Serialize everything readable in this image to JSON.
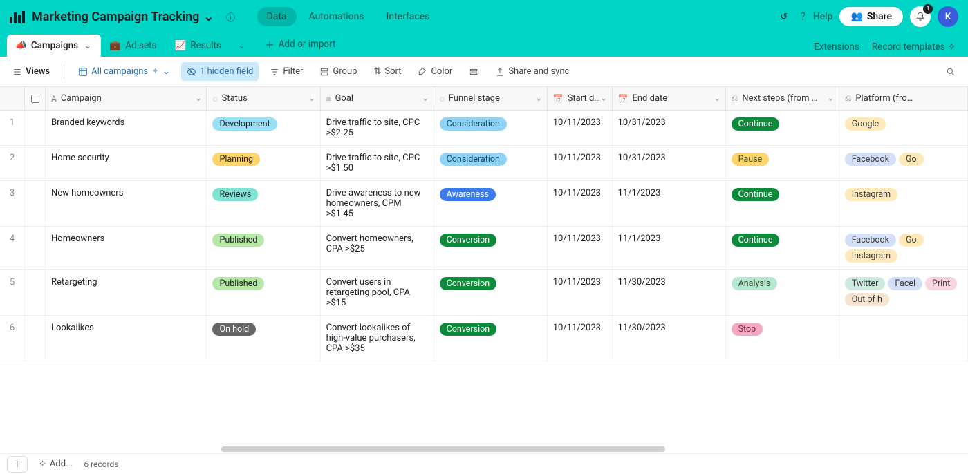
{
  "header": {
    "title": "Marketing Campaign Tracking",
    "nav": {
      "data": "Data",
      "automations": "Automations",
      "interfaces": "Interfaces"
    },
    "help": "Help",
    "share": "Share",
    "notif_count": "1",
    "avatar_initial": "K"
  },
  "tabs": {
    "campaigns": {
      "emoji": "📣",
      "label": "Campaigns"
    },
    "adsets": {
      "emoji": "💼",
      "label": "Ad sets"
    },
    "results": {
      "emoji": "📈",
      "label": "Results"
    },
    "add": "Add or import",
    "extensions": "Extensions",
    "templates": "Record templates"
  },
  "toolbar": {
    "views": "Views",
    "all": "All campaigns",
    "hidden": "1 hidden field",
    "filter": "Filter",
    "group": "Group",
    "sort": "Sort",
    "color": "Color",
    "share_sync": "Share and sync"
  },
  "columns": {
    "campaign": "Campaign",
    "status": "Status",
    "goal": "Goal",
    "funnel": "Funnel stage",
    "start": "Start d…",
    "end": "End date",
    "next": "Next steps (from …",
    "platform": "Platform (fro…"
  },
  "status_colors": {
    "Development": "#97e1f7",
    "Planning": "#ffd56b",
    "Reviews": "#7ee3d2",
    "Published": "#b5e8a4",
    "On hold": "#666"
  },
  "funnel_colors": {
    "Consideration": "#8fd4f7",
    "Awareness": "#3b7bf0",
    "Conversion": "#0d8a3a"
  },
  "next_colors": {
    "Continue": "#0d8a3a",
    "Pause": "#ffd56b",
    "Analysis": "#b5e8d0",
    "Stop": "#f5a8c0"
  },
  "platform_colors": {
    "Google": "#ffe9b8",
    "Facebook": "#d4e0f7",
    "Instagram": "#ffe9b8",
    "Twitter": "#cde9e0",
    "Print": "#f7d4e0",
    "Out of h": "#f5e4d0",
    "Go": "#ffe9b8",
    "Facel": "#d4e0f7"
  },
  "rows": [
    {
      "n": "1",
      "name": "Branded keywords",
      "status": "Development",
      "goal": "Drive traffic to site, CPC >$2.25",
      "funnel": "Consideration",
      "start": "10/11/2023",
      "end": "10/31/2023",
      "next": "Continue",
      "platforms": [
        "Google"
      ]
    },
    {
      "n": "2",
      "name": "Home security",
      "status": "Planning",
      "goal": "Drive traffic to site, CPC >$1.50",
      "funnel": "Consideration",
      "start": "10/11/2023",
      "end": "10/31/2023",
      "next": "Pause",
      "platforms": [
        "Facebook",
        "Go"
      ]
    },
    {
      "n": "3",
      "name": "New homeowners",
      "status": "Reviews",
      "goal": "Drive awareness to new homeowners, CPM >$1.45",
      "funnel": "Awareness",
      "start": "10/11/2023",
      "end": "11/1/2023",
      "next": "Continue",
      "platforms": [
        "Instagram"
      ]
    },
    {
      "n": "4",
      "name": "Homeowners",
      "status": "Published",
      "goal": "Convert homeowners, CPA >$25",
      "funnel": "Conversion",
      "start": "10/11/2023",
      "end": "11/1/2023",
      "next": "Continue",
      "platforms": [
        "Facebook",
        "Go",
        "Instagram"
      ]
    },
    {
      "n": "5",
      "name": "Retargeting",
      "status": "Published",
      "goal": "Convert users in retargeting pool, CPA >$15",
      "funnel": "Conversion",
      "start": "10/11/2023",
      "end": "11/30/2023",
      "next": "Analysis",
      "platforms": [
        "Twitter",
        "Facel",
        "Print",
        "Out of h"
      ]
    },
    {
      "n": "6",
      "name": "Lookalikes",
      "status": "On hold",
      "goal": "Convert lookalikes of high-value purchasers, CPA >$35",
      "funnel": "Conversion",
      "start": "10/11/2023",
      "end": "11/30/2023",
      "next": "Stop",
      "platforms": []
    }
  ],
  "footer": {
    "add": "Add...",
    "count": "6 records"
  }
}
